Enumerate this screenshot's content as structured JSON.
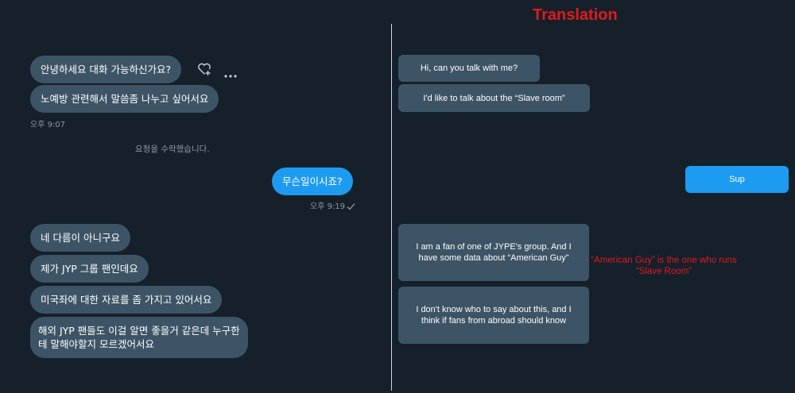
{
  "title": "Translation",
  "left_chat": {
    "msg1": "안녕하세요 대화 가능하신가요?",
    "msg2": "노예방 관련해서 말씀좀 나누고 싶어서요",
    "time1": "오후 9:07",
    "system": "요청을 수락했습니다.",
    "reply": "무슨일이시죠?",
    "time2": "오후 9:19",
    "msg3": "네 다름이 아니구요",
    "msg4": "제가 JYP 그룹 팬인데요",
    "msg5": "미국좌에 대한 자료를 좀 가지고 있어서요",
    "msg6": "해외 JYP 팬들도 이걸 알면 좋을거 같은데 누구한테 말해야할지 모르겠어서요"
  },
  "translation": {
    "t1": "Hi, can you talk with me?",
    "t2": "I'd like to talk about the “Slave room”",
    "t3": "Sup",
    "t4": "I am a fan of one of JYPE's group. And I have some data about “American Guy”",
    "t5": "I don't know who to say about this, and I think if fans from abroad should know",
    "note": "“American Guy” is the one who runs “Slave Room”"
  },
  "icons": {
    "react": "heart-plus-icon",
    "more": "more-dots-icon",
    "read": "checkmark-icon"
  }
}
